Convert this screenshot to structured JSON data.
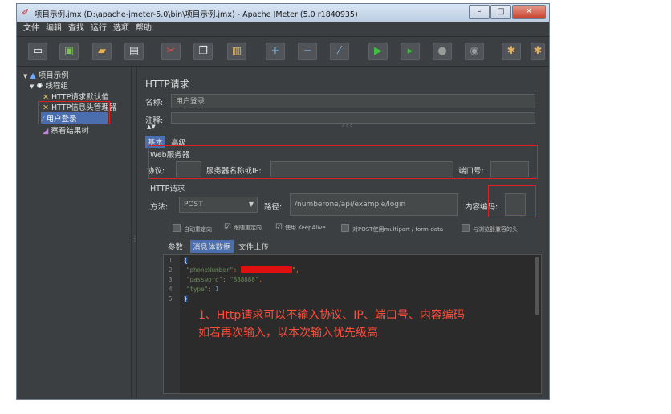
{
  "window": {
    "title": "项目示例.jmx (D:\\apache-jmeter-5.0\\bin\\项目示例.jmx) - Apache JMeter (5.0 r1840935)",
    "minimize": "–",
    "maximize": "□",
    "close": "✕"
  },
  "menu": [
    "文件",
    "编辑",
    "查找",
    "运行",
    "选项",
    "帮助"
  ],
  "toolbar": [
    "new-icon",
    "template-icon",
    "open-icon",
    "save-icon",
    "cut-icon",
    "copy-icon",
    "paste-icon",
    "expand-icon",
    "collapse-icon",
    "toggle-icon",
    "start-icon",
    "start-no-pause-icon",
    "stop-icon",
    "shutdown-icon",
    "clear-icon",
    "clear-all-icon"
  ],
  "tree": {
    "root": "项目示例",
    "thread_group": "线程组",
    "items": [
      "HTTP请求默认值",
      "HTTP信息头管理器",
      "用户登录",
      "察看结果树"
    ]
  },
  "panel": {
    "title": "HTTP请求",
    "name_label": "名称:",
    "name_value": "用户登录",
    "comment_label": "注释:",
    "tabs": [
      "基本",
      "高级"
    ],
    "web_server": {
      "section": "Web服务器",
      "protocol_label": "协议:",
      "server_label": "服务器名称或IP:",
      "port_label": "端口号:"
    },
    "http_request": {
      "section": "HTTP请求",
      "method_label": "方法:",
      "method_value": "POST",
      "path_label": "路径:",
      "path_value": "/numberone/api/example/login",
      "encoding_label": "内容编码:"
    },
    "checkboxes": [
      {
        "label": "自动重定向",
        "checked": false
      },
      {
        "label": "跟随重定向",
        "checked": true
      },
      {
        "label": "使用 KeepAlive",
        "checked": true
      },
      {
        "label": "对POST使用multipart / form-data",
        "checked": false
      },
      {
        "label": "与浏览器兼容的头",
        "checked": false
      }
    ],
    "body_tabs": [
      "参数",
      "消息体数据",
      "文件上传"
    ],
    "code": {
      "line_numbers": [
        "1",
        "2",
        "3",
        "4",
        "5"
      ],
      "open": "{",
      "k1": "\"phoneNumber\"",
      "colon": ": ",
      "v1_tail": "\",",
      "k2": "\"password\"",
      "v2": "\"888888\"",
      "comma": ",",
      "k3": "\"type\"",
      "v3": "1",
      "close": "}"
    }
  },
  "annotation": {
    "line1": "1、Http请求可以不输入协议、IP、端口号、内容编码",
    "line2": "如若再次输入，以本次输入优先级高"
  }
}
